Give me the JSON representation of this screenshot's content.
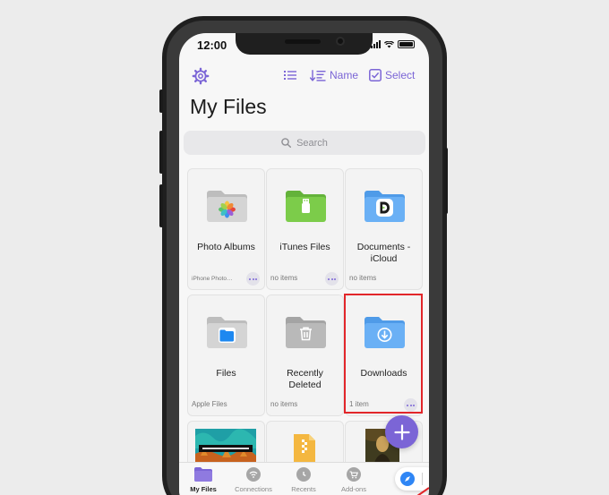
{
  "status_bar": {
    "time": "12:00"
  },
  "toolbar": {
    "sort_label": "Name",
    "select_label": "Select"
  },
  "page": {
    "title": "My Files"
  },
  "search": {
    "placeholder": "Search"
  },
  "tiles": [
    {
      "name": "Photo Albums",
      "sub": "iPhone Photo…",
      "icon": "photos-folder-icon"
    },
    {
      "name": "iTunes Files",
      "sub": "no items",
      "icon": "itunes-usb-folder-icon"
    },
    {
      "name": "Documents - iCloud",
      "sub": "no items",
      "icon": "documents-icloud-folder-icon"
    },
    {
      "name": "Files",
      "sub": "Apple Files",
      "icon": "files-app-folder-icon"
    },
    {
      "name": "Recently Deleted",
      "sub": "no items",
      "icon": "trash-folder-icon"
    },
    {
      "name": "Downloads",
      "sub": "1 item",
      "icon": "download-folder-icon"
    }
  ],
  "tabs": [
    {
      "label": "My Files",
      "icon": "folder-icon",
      "active": true
    },
    {
      "label": "Connections",
      "icon": "wifi-icon",
      "active": false
    },
    {
      "label": "Recents",
      "icon": "clock-icon",
      "active": false
    },
    {
      "label": "Add-ons",
      "icon": "cart-icon",
      "active": false
    }
  ],
  "colors": {
    "accent": "#7b65d6",
    "folder_blue": "#6ab0f5",
    "folder_gray": "#d4d4d4",
    "folder_green": "#7ccc4a",
    "highlight": "#e2262a"
  }
}
